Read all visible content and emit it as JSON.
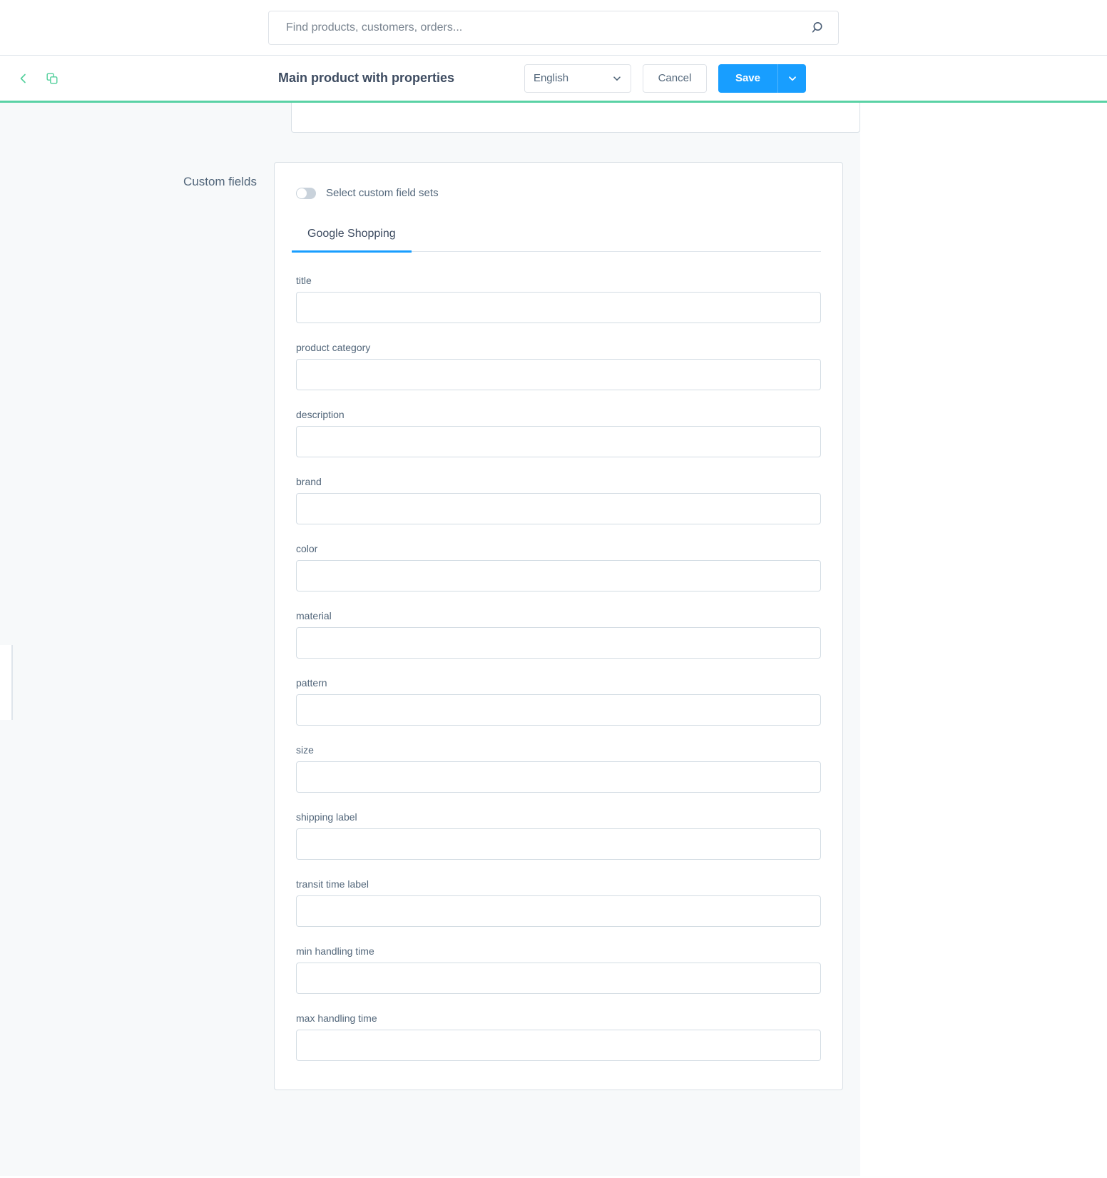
{
  "search": {
    "placeholder": "Find products, customers, orders...",
    "value": "",
    "icon": "search-icon"
  },
  "header": {
    "back_icon": "chevron-left-icon",
    "duplicate_icon": "duplicate-icon",
    "title": "Main product with properties",
    "language": {
      "selected": "English",
      "chevron_icon": "chevron-down-icon"
    },
    "cancel_label": "Cancel",
    "save_label": "Save",
    "save_dropdown_icon": "chevron-down-icon",
    "accent_color": "#5ad2a5",
    "primary_color": "#189eff"
  },
  "section": {
    "label": "Custom fields",
    "toggle": {
      "label": "Select custom field sets",
      "state": "off"
    },
    "tabs": [
      {
        "label": "Google Shopping",
        "active": true
      }
    ],
    "fields": [
      {
        "label": "title",
        "value": ""
      },
      {
        "label": "product category",
        "value": ""
      },
      {
        "label": "description",
        "value": ""
      },
      {
        "label": "brand",
        "value": ""
      },
      {
        "label": "color",
        "value": ""
      },
      {
        "label": "material",
        "value": ""
      },
      {
        "label": "pattern",
        "value": ""
      },
      {
        "label": "size",
        "value": ""
      },
      {
        "label": "shipping label",
        "value": ""
      },
      {
        "label": "transit time label",
        "value": ""
      },
      {
        "label": "min handling time",
        "value": ""
      },
      {
        "label": "max handling time",
        "value": ""
      }
    ]
  }
}
